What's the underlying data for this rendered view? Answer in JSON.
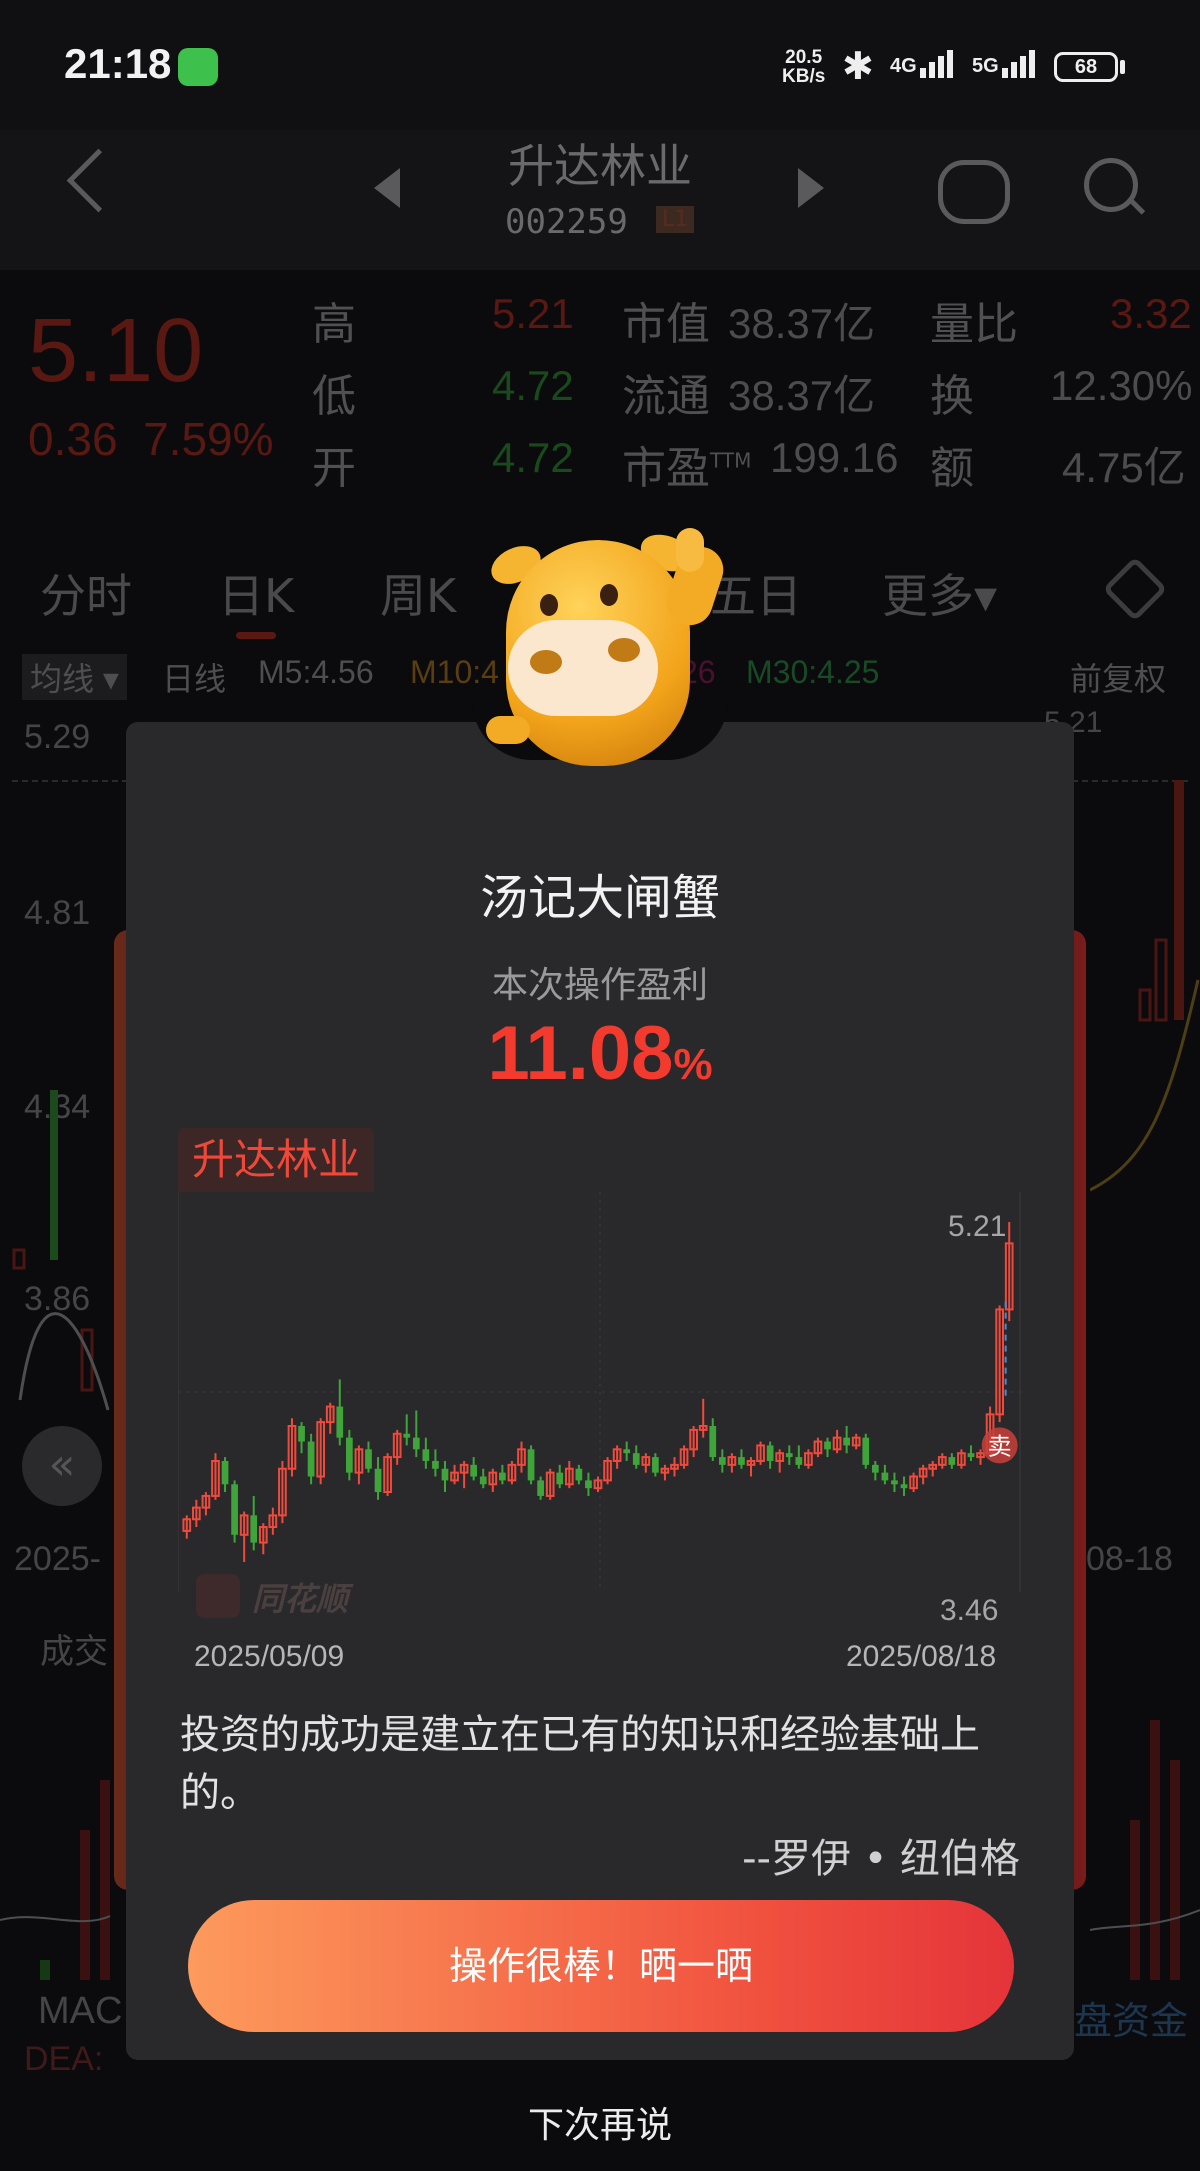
{
  "status_bar": {
    "time": "21:18",
    "net_speed_value": "20.5",
    "net_speed_unit": "KB/s",
    "sig1_label": "4G",
    "sig2_label": "5G",
    "battery": "68"
  },
  "header": {
    "stock_name": "升达林业",
    "stock_code": "002259",
    "level_badge": "L1"
  },
  "quote": {
    "price": "5.10",
    "change": "0.36",
    "change_pct": "7.59%",
    "high_label": "高",
    "high": "5.21",
    "low_label": "低",
    "low": "4.72",
    "open_label": "开",
    "open": "4.72",
    "mktcap_label": "市值",
    "mktcap": "38.37亿",
    "float_label": "流通",
    "float": "38.37亿",
    "pe_label": "市盈",
    "pe_sup": "TTM",
    "pe": "199.16",
    "vol_ratio_label": "量比",
    "vol_ratio": "3.32",
    "turnover_label": "换",
    "turnover": "12.30%",
    "amount_label": "额",
    "amount": "4.75亿"
  },
  "tabs": [
    "分时",
    "日K",
    "周K",
    "五日",
    "更多▾"
  ],
  "ma_bar": {
    "avg_select": "均线 ▾",
    "period": "日线",
    "m5": "M5:4.56",
    "m10": "M10:4",
    "m20": "26",
    "m30": "M30:4.25",
    "adjust": "前复权"
  },
  "bg_axis": {
    "y1": "5.29",
    "y2": "4.81",
    "y3": "4.34",
    "y4": "3.86",
    "date_left": "2025-",
    "date_right": "08-18",
    "vol_label": "成交",
    "macd_label": "MAC",
    "dea_label": "DEA:",
    "right_label": "盘资金",
    "right_price": "5.21"
  },
  "modal": {
    "title": "汤记大闸蟹",
    "profit_label": "本次操作盈利",
    "profit_value": "11.08",
    "profit_unit": "%",
    "stock_tag": "升达林业",
    "watermark": "同花顺",
    "quote_text": "投资的成功是建立在已有的知识和经验基础上的。",
    "quote_author": "--罗伊 • 纽伯格",
    "cta_label": "操作很棒！晒一晒",
    "dismiss_label": "下次再说",
    "sell_marker": "卖"
  },
  "chart_data": {
    "type": "candlestick",
    "x_start": "2025/05/09",
    "x_end": "2025/08/18",
    "y_max_label": "5.21",
    "y_min_label": "3.46",
    "ylim": [
      3.46,
      5.21
    ],
    "colors": {
      "up": "#f04a3c",
      "down": "#3fa53b"
    },
    "ohlc": [
      [
        3.62,
        3.7,
        3.58,
        3.68
      ],
      [
        3.68,
        3.78,
        3.64,
        3.74
      ],
      [
        3.74,
        3.82,
        3.7,
        3.8
      ],
      [
        3.8,
        4.02,
        3.78,
        3.98
      ],
      [
        3.98,
        4.0,
        3.82,
        3.86
      ],
      [
        3.86,
        3.88,
        3.56,
        3.6
      ],
      [
        3.6,
        3.72,
        3.46,
        3.7
      ],
      [
        3.7,
        3.8,
        3.52,
        3.56
      ],
      [
        3.56,
        3.66,
        3.5,
        3.64
      ],
      [
        3.64,
        3.74,
        3.6,
        3.7
      ],
      [
        3.7,
        3.98,
        3.66,
        3.94
      ],
      [
        3.94,
        4.2,
        3.9,
        4.16
      ],
      [
        4.16,
        4.18,
        4.02,
        4.08
      ],
      [
        4.08,
        4.12,
        3.86,
        3.9
      ],
      [
        3.9,
        4.2,
        3.86,
        4.18
      ],
      [
        4.18,
        4.28,
        4.12,
        4.26
      ],
      [
        4.26,
        4.4,
        4.06,
        4.1
      ],
      [
        4.1,
        4.14,
        3.88,
        3.92
      ],
      [
        3.92,
        4.06,
        3.86,
        4.04
      ],
      [
        4.04,
        4.08,
        3.92,
        3.94
      ],
      [
        3.94,
        4.0,
        3.78,
        3.82
      ],
      [
        3.82,
        4.02,
        3.8,
        4.0
      ],
      [
        4.0,
        4.14,
        3.96,
        4.12
      ],
      [
        4.12,
        4.22,
        4.06,
        4.1
      ],
      [
        4.1,
        4.24,
        4.0,
        4.04
      ],
      [
        4.04,
        4.1,
        3.94,
        3.98
      ],
      [
        3.98,
        4.04,
        3.9,
        3.94
      ],
      [
        3.94,
        3.98,
        3.82,
        3.88
      ],
      [
        3.88,
        3.96,
        3.86,
        3.92
      ],
      [
        3.92,
        3.98,
        3.84,
        3.96
      ],
      [
        3.96,
        4.0,
        3.88,
        3.9
      ],
      [
        3.9,
        3.94,
        3.84,
        3.86
      ],
      [
        3.86,
        3.94,
        3.82,
        3.92
      ],
      [
        3.92,
        3.96,
        3.86,
        3.88
      ],
      [
        3.88,
        3.98,
        3.86,
        3.96
      ],
      [
        3.96,
        4.08,
        3.92,
        4.04
      ],
      [
        4.04,
        4.06,
        3.86,
        3.88
      ],
      [
        3.88,
        3.9,
        3.78,
        3.8
      ],
      [
        3.8,
        3.94,
        3.78,
        3.92
      ],
      [
        3.92,
        3.96,
        3.84,
        3.86
      ],
      [
        3.86,
        3.98,
        3.84,
        3.94
      ],
      [
        3.94,
        3.96,
        3.86,
        3.88
      ],
      [
        3.88,
        3.92,
        3.8,
        3.84
      ],
      [
        3.84,
        3.9,
        3.82,
        3.88
      ],
      [
        3.88,
        4.0,
        3.86,
        3.98
      ],
      [
        3.98,
        4.06,
        3.94,
        4.04
      ],
      [
        4.04,
        4.08,
        3.98,
        4.02
      ],
      [
        4.02,
        4.06,
        3.94,
        3.96
      ],
      [
        3.96,
        4.02,
        3.92,
        4.0
      ],
      [
        4.0,
        4.02,
        3.9,
        3.92
      ],
      [
        3.92,
        3.96,
        3.88,
        3.94
      ],
      [
        3.94,
        4.0,
        3.9,
        3.96
      ],
      [
        3.96,
        4.06,
        3.94,
        4.04
      ],
      [
        4.04,
        4.16,
        4.0,
        4.14
      ],
      [
        4.14,
        4.3,
        4.1,
        4.16
      ],
      [
        4.16,
        4.2,
        3.98,
        4.0
      ],
      [
        4.0,
        4.04,
        3.92,
        3.96
      ],
      [
        3.96,
        4.02,
        3.92,
        4.0
      ],
      [
        4.0,
        4.04,
        3.94,
        3.96
      ],
      [
        3.96,
        4.0,
        3.9,
        3.98
      ],
      [
        3.98,
        4.08,
        3.96,
        4.06
      ],
      [
        4.06,
        4.08,
        3.94,
        3.98
      ],
      [
        3.98,
        4.04,
        3.92,
        4.02
      ],
      [
        4.02,
        4.06,
        3.96,
        4.0
      ],
      [
        4.0,
        4.06,
        3.94,
        3.96
      ],
      [
        3.96,
        4.04,
        3.94,
        4.02
      ],
      [
        4.02,
        4.1,
        4.0,
        4.08
      ],
      [
        4.08,
        4.1,
        4.0,
        4.04
      ],
      [
        4.04,
        4.14,
        4.02,
        4.1
      ],
      [
        4.1,
        4.16,
        4.02,
        4.06
      ],
      [
        4.06,
        4.12,
        4.04,
        4.1
      ],
      [
        4.1,
        4.12,
        3.94,
        3.96
      ],
      [
        3.96,
        3.98,
        3.88,
        3.92
      ],
      [
        3.92,
        3.96,
        3.86,
        3.88
      ],
      [
        3.88,
        3.92,
        3.82,
        3.86
      ],
      [
        3.86,
        3.9,
        3.8,
        3.84
      ],
      [
        3.84,
        3.92,
        3.82,
        3.9
      ],
      [
        3.9,
        3.96,
        3.86,
        3.94
      ],
      [
        3.94,
        3.98,
        3.9,
        3.96
      ],
      [
        3.96,
        4.02,
        3.94,
        4.0
      ],
      [
        4.0,
        4.02,
        3.94,
        3.96
      ],
      [
        3.96,
        4.04,
        3.94,
        4.02
      ],
      [
        4.02,
        4.06,
        3.98,
        4.0
      ],
      [
        4.0,
        4.04,
        3.96,
        4.02
      ],
      [
        4.02,
        4.26,
        4.0,
        4.22
      ],
      [
        4.22,
        4.78,
        4.18,
        4.76
      ],
      [
        4.76,
        5.21,
        4.7,
        5.1
      ]
    ]
  }
}
